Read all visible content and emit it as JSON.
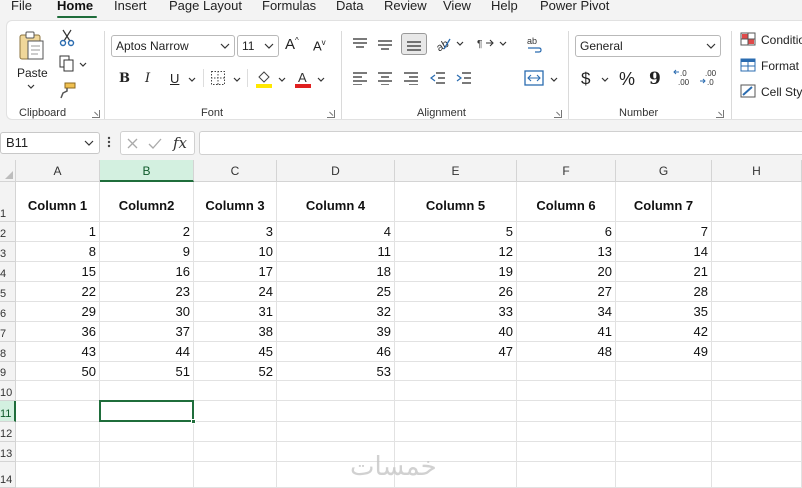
{
  "menu": {
    "tabs": [
      "File",
      "Home",
      "Insert",
      "Page Layout",
      "Formulas",
      "Data",
      "Review",
      "View",
      "Help",
      "Power Pivot"
    ],
    "active": "Home"
  },
  "ribbon": {
    "clipboard": {
      "label": "Clipboard",
      "paste_label": "Paste"
    },
    "font": {
      "label": "Font",
      "font_name": "Aptos Narrow",
      "font_size": "11",
      "bold": "B",
      "italic": "I",
      "underline": "U"
    },
    "alignment": {
      "label": "Alignment"
    },
    "number": {
      "label": "Number",
      "format": "General",
      "currency": "$",
      "percent": "%",
      "comma": "9"
    },
    "styles": {
      "conditional_label": "Conditio",
      "format_label": "Format a",
      "cell_styles_label": "Cell Styl"
    }
  },
  "formula_bar": {
    "name_box": "B11",
    "fx": "fx",
    "formula": ""
  },
  "sheet": {
    "columns": [
      "A",
      "B",
      "C",
      "D",
      "E",
      "F",
      "G",
      "H"
    ],
    "rows": [
      "1",
      "2",
      "3",
      "4",
      "5",
      "6",
      "7",
      "8",
      "9",
      "10",
      "11",
      "12",
      "13",
      "14"
    ],
    "headers": [
      "Column 1",
      "Column2",
      "Column 3",
      "Column 4",
      "Column 5",
      "Column 6",
      "Column 7"
    ],
    "data": [
      [
        "1",
        "2",
        "3",
        "4",
        "5",
        "6",
        "7"
      ],
      [
        "8",
        "9",
        "10",
        "11",
        "12",
        "13",
        "14"
      ],
      [
        "15",
        "16",
        "17",
        "18",
        "19",
        "20",
        "21"
      ],
      [
        "22",
        "23",
        "24",
        "25",
        "26",
        "27",
        "28"
      ],
      [
        "29",
        "30",
        "31",
        "32",
        "33",
        "34",
        "35"
      ],
      [
        "36",
        "37",
        "38",
        "39",
        "40",
        "41",
        "42"
      ],
      [
        "43",
        "44",
        "45",
        "46",
        "47",
        "48",
        "49"
      ],
      [
        "50",
        "51",
        "52",
        "53",
        "",
        "",
        ""
      ]
    ],
    "active_cell": "B11",
    "watermark": "خمسات"
  }
}
